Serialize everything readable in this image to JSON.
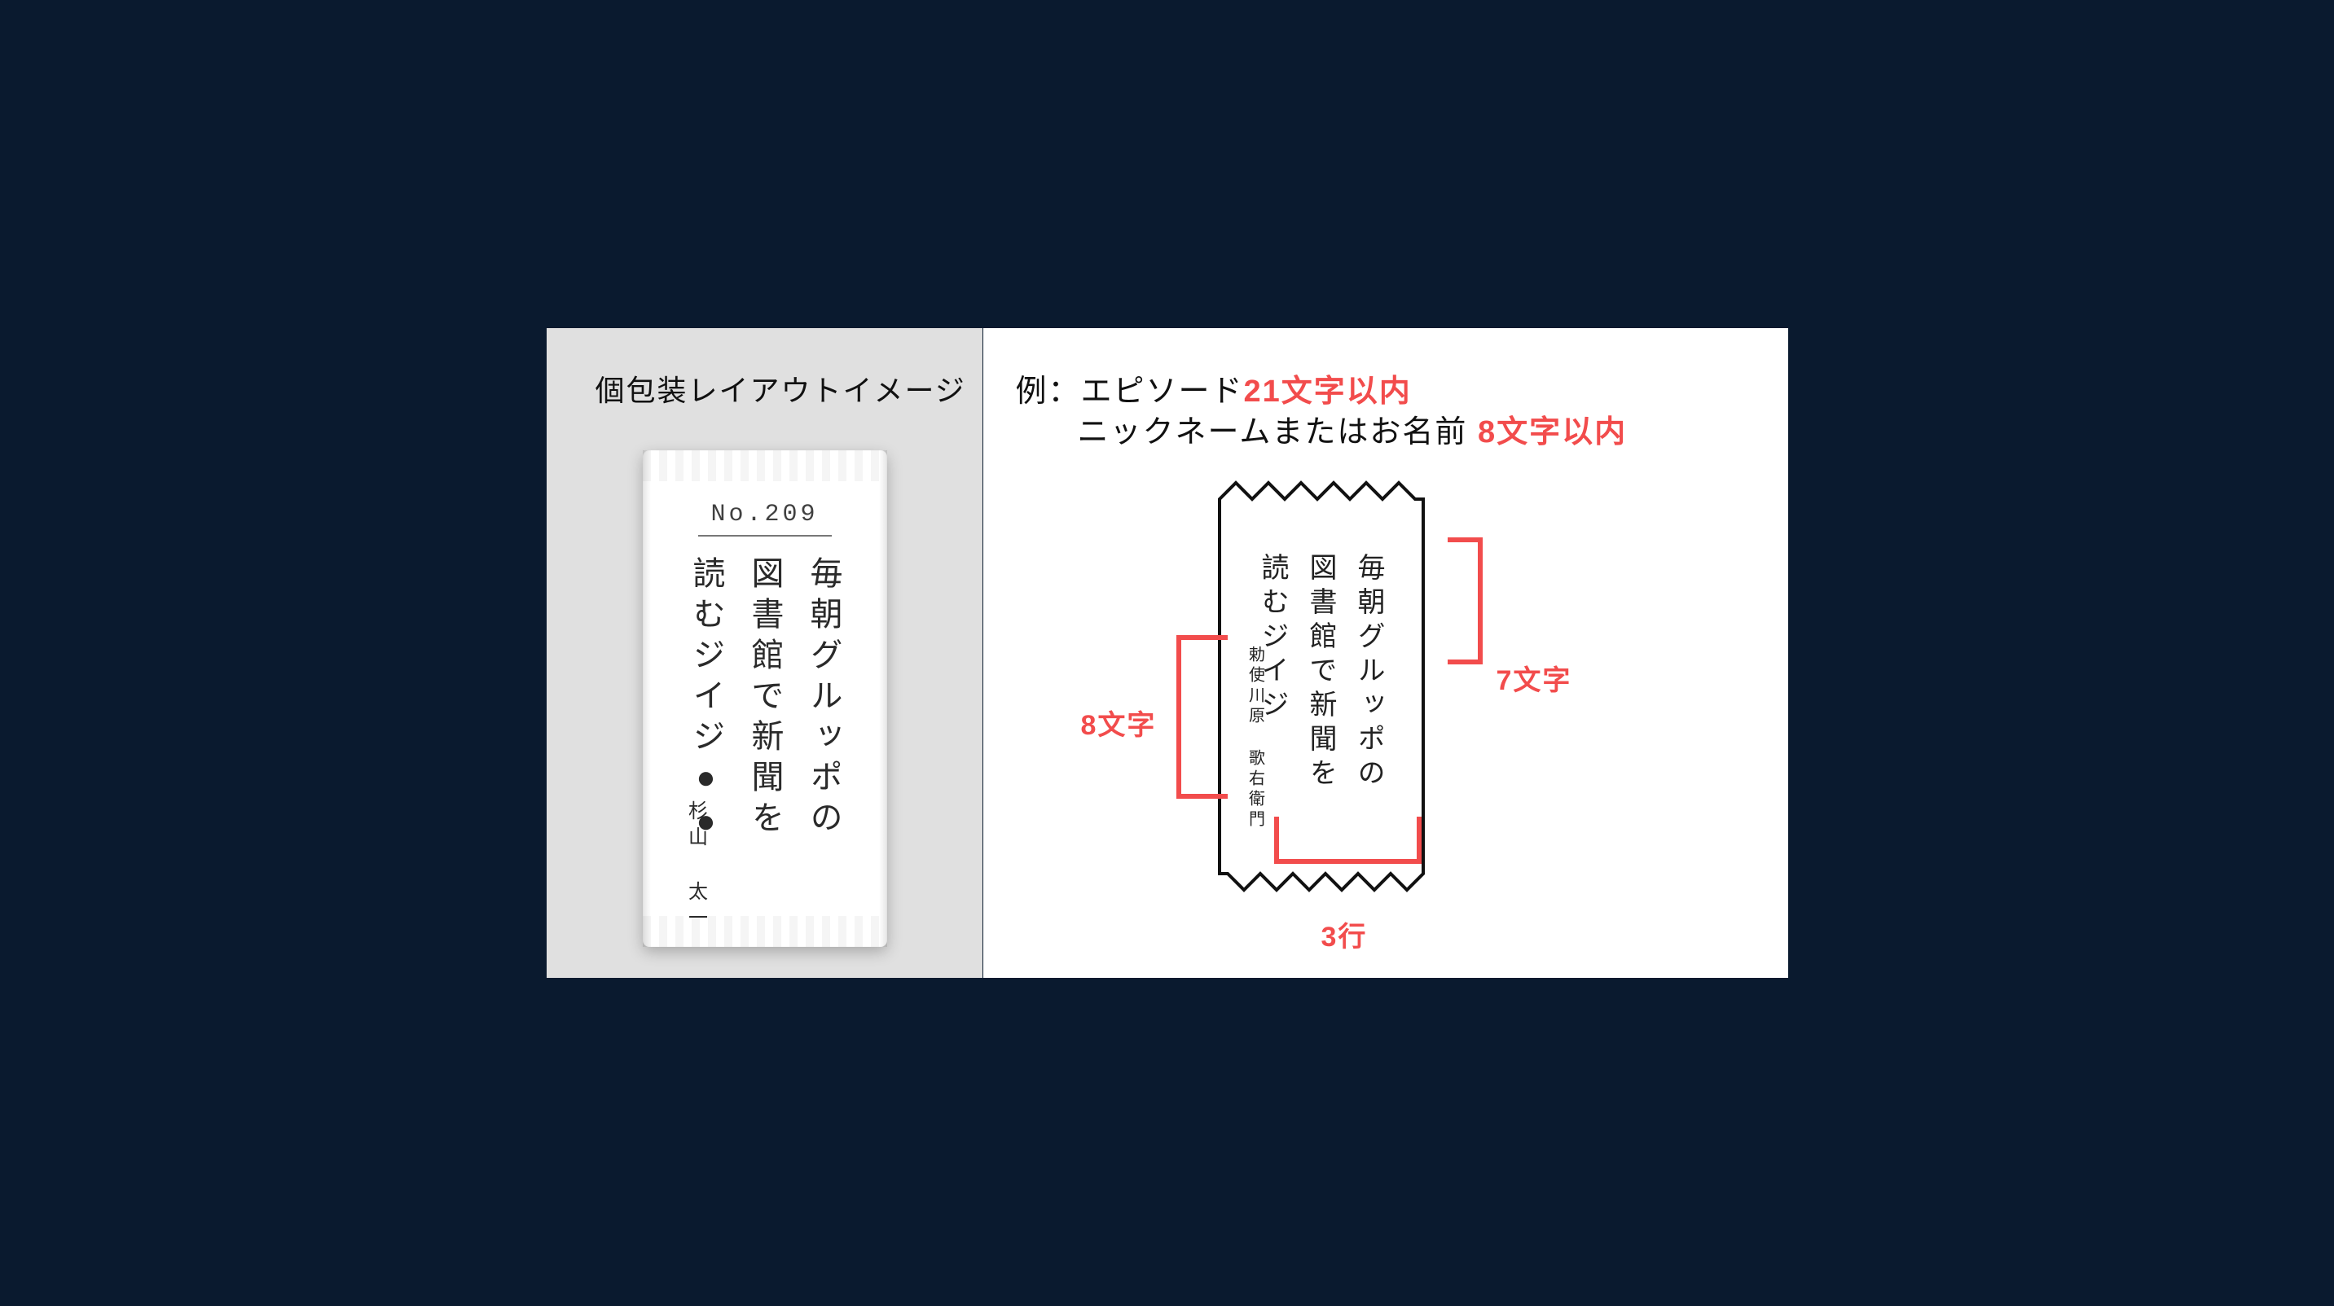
{
  "leftPanel": {
    "title": "個包装レイアウトイメージ",
    "numberLabel": "No.209",
    "episode": {
      "col1": "毎朝グルッポの",
      "col2": "図書館で新聞を",
      "col3": "読むジイジ●●"
    },
    "authorName": "杉山 太一"
  },
  "rightPanel": {
    "header": {
      "line1Prefix": "例：エピソード",
      "line1Limit": "21文字以内",
      "line2Prefix": "ニックネームまたはお名前",
      "line2Limit": "8文字以内"
    },
    "diagram": {
      "episode": {
        "col1": "毎朝グルッポの",
        "col2": "図書館で新聞を",
        "col3": "読むジイジ"
      },
      "authorName": "勅使川原 歌右衛門"
    },
    "callouts": {
      "charsPerLine": "7文字",
      "nameChars": "8文字",
      "lineCount": "3行"
    }
  }
}
